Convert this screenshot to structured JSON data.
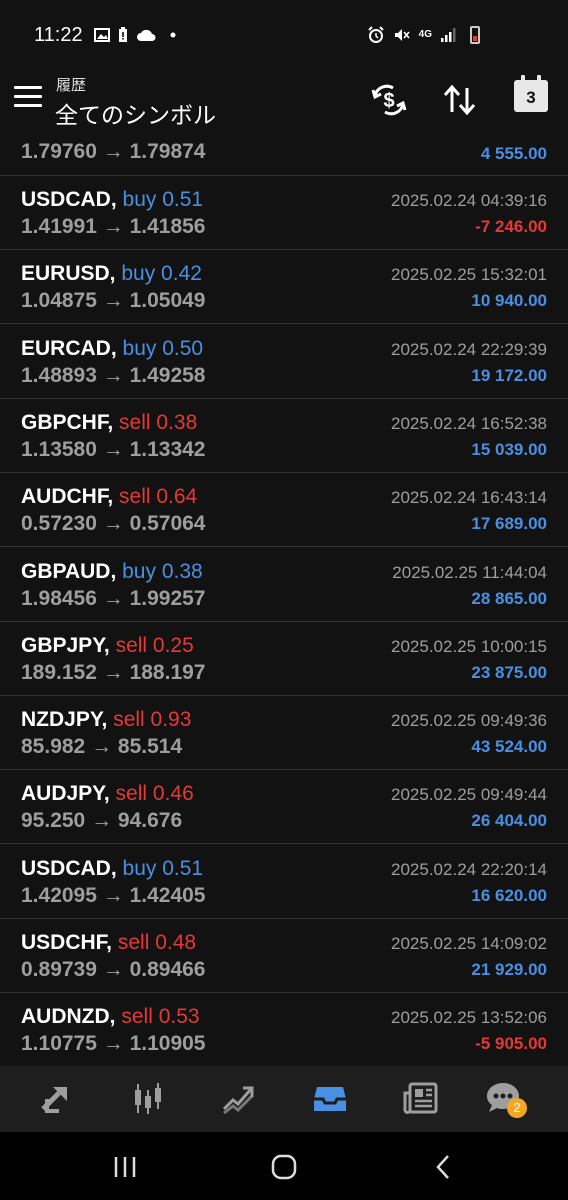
{
  "status_bar": {
    "time": "11:22",
    "network": "4G"
  },
  "header": {
    "subtitle": "履歴",
    "title": "全てのシンボル",
    "calendar_day": "3",
    "icons": [
      "menu-icon",
      "currency-exchange-icon",
      "sort-icon",
      "calendar-icon"
    ]
  },
  "partial_row": {
    "prices": "1.79760 → 1.79874",
    "profit": "4 555.00"
  },
  "trades": [
    {
      "symbol": "USDCAD,",
      "side": "buy 0.51",
      "type": "buy",
      "prices": "1.41991 → 1.41856",
      "time": "2025.02.24 04:39:16",
      "profit": "-7 246.00",
      "positive": false
    },
    {
      "symbol": "EURUSD,",
      "side": "buy 0.42",
      "type": "buy",
      "prices": "1.04875 → 1.05049",
      "time": "2025.02.25 15:32:01",
      "profit": "10 940.00",
      "positive": true
    },
    {
      "symbol": "EURCAD,",
      "side": "buy 0.50",
      "type": "buy",
      "prices": "1.48893 → 1.49258",
      "time": "2025.02.24 22:29:39",
      "profit": "19 172.00",
      "positive": true
    },
    {
      "symbol": "GBPCHF,",
      "side": "sell 0.38",
      "type": "sell",
      "prices": "1.13580 → 1.13342",
      "time": "2025.02.24 16:52:38",
      "profit": "15 039.00",
      "positive": true
    },
    {
      "symbol": "AUDCHF,",
      "side": "sell 0.64",
      "type": "sell",
      "prices": "0.57230 → 0.57064",
      "time": "2025.02.24 16:43:14",
      "profit": "17 689.00",
      "positive": true
    },
    {
      "symbol": "GBPAUD,",
      "side": "buy 0.38",
      "type": "buy",
      "prices": "1.98456 → 1.99257",
      "time": "2025.02.25 11:44:04",
      "profit": "28 865.00",
      "positive": true
    },
    {
      "symbol": "GBPJPY,",
      "side": "sell 0.25",
      "type": "sell",
      "prices": "189.152 → 188.197",
      "time": "2025.02.25 10:00:15",
      "profit": "23 875.00",
      "positive": true
    },
    {
      "symbol": "NZDJPY,",
      "side": "sell 0.93",
      "type": "sell",
      "prices": "85.982 → 85.514",
      "time": "2025.02.25 09:49:36",
      "profit": "43 524.00",
      "positive": true
    },
    {
      "symbol": "AUDJPY,",
      "side": "sell 0.46",
      "type": "sell",
      "prices": "95.250 → 94.676",
      "time": "2025.02.25 09:49:44",
      "profit": "26 404.00",
      "positive": true
    },
    {
      "symbol": "USDCAD,",
      "side": "buy 0.51",
      "type": "buy",
      "prices": "1.42095 → 1.42405",
      "time": "2025.02.24 22:20:14",
      "profit": "16 620.00",
      "positive": true
    },
    {
      "symbol": "USDCHF,",
      "side": "sell 0.48",
      "type": "sell",
      "prices": "0.89739 → 0.89466",
      "time": "2025.02.25 14:09:02",
      "profit": "21 929.00",
      "positive": true
    },
    {
      "symbol": "AUDNZD,",
      "side": "sell 0.53",
      "type": "sell",
      "prices": "1.10775 → 1.10905",
      "time": "2025.02.25 13:52:06",
      "profit": "-5 905.00",
      "positive": false
    }
  ],
  "bottom_nav": {
    "items": [
      "quotes-icon",
      "chart-icon",
      "trade-icon",
      "history-icon",
      "news-icon",
      "chat-icon"
    ],
    "active": "history-icon",
    "chat_badge": "2"
  },
  "colors": {
    "background": "#121212",
    "buy": "#4a90e2",
    "sell": "#e53935",
    "positive": "#4a90e2",
    "negative": "#e53935",
    "active_nav": "#4a90e2"
  }
}
